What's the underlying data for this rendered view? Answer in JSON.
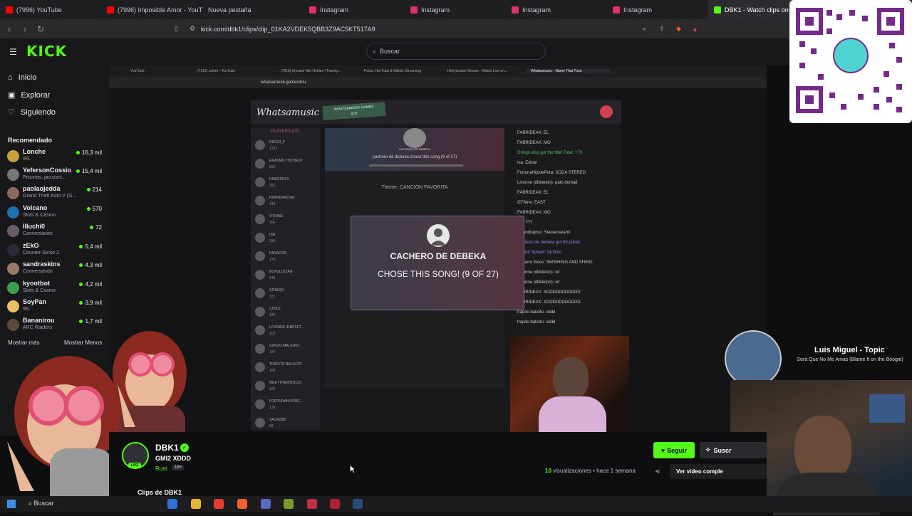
{
  "browser": {
    "tabs": [
      {
        "label": "(7996) YouTube",
        "color": "#ff0000"
      },
      {
        "label": "(7996) Imposible Amor - YouTu...",
        "color": "#ff0000"
      },
      {
        "label": "Nueva pestaña",
        "color": ""
      },
      {
        "label": "Instagram",
        "color": "#e1306c"
      },
      {
        "label": "Instagram",
        "color": "#e1306c"
      },
      {
        "label": "Instagram",
        "color": "#e1306c"
      },
      {
        "label": "Instagram",
        "color": "#e1306c"
      },
      {
        "label": "DBK1 - Watch clips on Ki...",
        "color": "#53fc18"
      }
    ],
    "url": "kick.com/dbk1/clips/clip_01KA2VDEK5QBB3Z9AC5KT517A9"
  },
  "kick": {
    "logo": "KICK",
    "search_placeholder": "Buscar",
    "nav": [
      {
        "label": "Inicio",
        "icon": "home-icon"
      },
      {
        "label": "Explorar",
        "icon": "compass-icon"
      },
      {
        "label": "Siguiendo",
        "icon": "heart-icon"
      }
    ],
    "recommended_title": "Recomendado",
    "channels": [
      {
        "name": "Lonche",
        "category": "IRL",
        "viewers": "16,3 mil",
        "color": "#c9a03a"
      },
      {
        "name": "YefersonCossio",
        "category": "Piscinas, jacuzzis...",
        "viewers": "15,4 mil",
        "color": "#777"
      },
      {
        "name": "paolaojedda",
        "category": "Grand Theft Auto V (G...",
        "viewers": "214",
        "color": "#8a6a5a"
      },
      {
        "name": "Volcano",
        "category": "Slots & Casino",
        "viewers": "570",
        "color": "#1e6fb0"
      },
      {
        "name": "Illuchi0",
        "category": "Conversando",
        "viewers": "72",
        "color": "#6a5a6a"
      },
      {
        "name": "zEkO",
        "category": "Counter-Strike 2",
        "viewers": "5,4 mil",
        "color": "#2a2a3a"
      },
      {
        "name": "sandraskins",
        "category": "Conversando",
        "viewers": "4,3 mil",
        "color": "#9a7a6a"
      },
      {
        "name": "kyootbot",
        "category": "Slots & Casino",
        "viewers": "4,2 mil",
        "color": "#3aa050"
      },
      {
        "name": "SoyPan",
        "category": "IRL",
        "viewers": "3,9 mil",
        "color": "#e8c060"
      },
      {
        "name": "Bananirou",
        "category": "ARC Raiders",
        "viewers": "1,7 mil",
        "color": "#5a4a3a"
      }
    ],
    "show_more": "Mostrar más",
    "show_less": "Mostrar Menos"
  },
  "inner": {
    "tabs": [
      "YouTube",
      "(7319) sekiro - YouTube",
      "(7318) Armand Van Helden | Twenty...",
      "Pools, Hot Tubs & Bikinis Streaming",
      "hiheyitsdani Stream - Watch Live on...",
      "Whatsamusic - Name That Tune"
    ],
    "url": "whatsamook.games/mu",
    "game_title": "Whatsamusic",
    "badge": "WHATSAMOOK GAMES\nICIT",
    "players_header": "PLAYERS (27)",
    "players": [
      {
        "name": "DIEGO_F",
        "score": "1322"
      },
      {
        "name": "ERASMO TH3 BEST",
        "score": "682"
      },
      {
        "name": "FABRIDEAX",
        "score": "361"
      },
      {
        "name": "PKANDRA2000",
        "score": "348"
      },
      {
        "name": "OTNINE",
        "score": "306"
      },
      {
        "name": "ISA",
        "score": "284"
      },
      {
        "name": "PARADOR",
        "score": "270"
      },
      {
        "name": "BOKULUCIAN",
        "score": "249"
      },
      {
        "name": "GRINGO",
        "score": "221"
      },
      {
        "name": "CHIZO",
        "score": "220"
      },
      {
        "name": "LIVONNE (DBKTET...",
        "score": "202"
      },
      {
        "name": "GANZO MALIGNO",
        "score": "194"
      },
      {
        "name": "TRAPITO BALICITO",
        "score": "169"
      },
      {
        "name": "MEETTHEWOO123",
        "score": "169"
      },
      {
        "name": "FORTUNAHIJODE...",
        "score": "120"
      },
      {
        "name": "VACADBK",
        "score": "84"
      }
    ],
    "current_chooser": "CACHERO DE DEBEKA",
    "chose_small": "cachero de debeka chose this song (9 of 27)",
    "theme": "Theme: CANCION FAVORITA",
    "modal_line1": "CACHERO DE DEBEKA",
    "modal_line2": "CHOSE THIS SONG! (9 OF 27)",
    "chat": [
      "FABRIDEAX: EL",
      "FABRIDEAX: MO",
      "Gringo also got the title! Total: +70",
      "Isa: Edson",
      "FortunaHijodePuta: SODA STERED",
      "Livonne (dbkteton): pato donlad",
      "FABRIDEAX: EL",
      "OTNine: EAST",
      "FABRIDEAX: MO",
      "Isa: ???",
      "PKandrajoso: Seesenseami",
      "Cachero de debeka got 50 points",
      "\"Splish Splash\" by Bino",
      "Jilguero flores: SWISHING AND SHING",
      "Livonne (dbkteton): xd",
      "Livonne (dbkteton): xd",
      "FABRIDEAX: XDDDDDDDDDDD",
      "FABRIDEAX: XDDDDDDDDDDD",
      "trapito balicito: xddd",
      "trapito balicito: xddd"
    ]
  },
  "music": {
    "title": "Luis Miguel - Topic",
    "subtitle": "Será Que No Me Amas (Blame It on the Boogie)"
  },
  "clip": {
    "channel": "DBK1",
    "title": "GMI2 XDDD",
    "category": "Rust",
    "age": "18+",
    "live": "LIVE",
    "follow": "Seguir",
    "subscribe": "Suscr",
    "views_count": "10",
    "views_text": "visualizaciones • hace 1 semana",
    "full_video": "Ver video comple",
    "list_title": "Clips de DBK1"
  },
  "taskbar": {
    "search": "Buscar"
  },
  "colors": {
    "kick_green": "#53fc18",
    "background": "#0e0e10"
  }
}
